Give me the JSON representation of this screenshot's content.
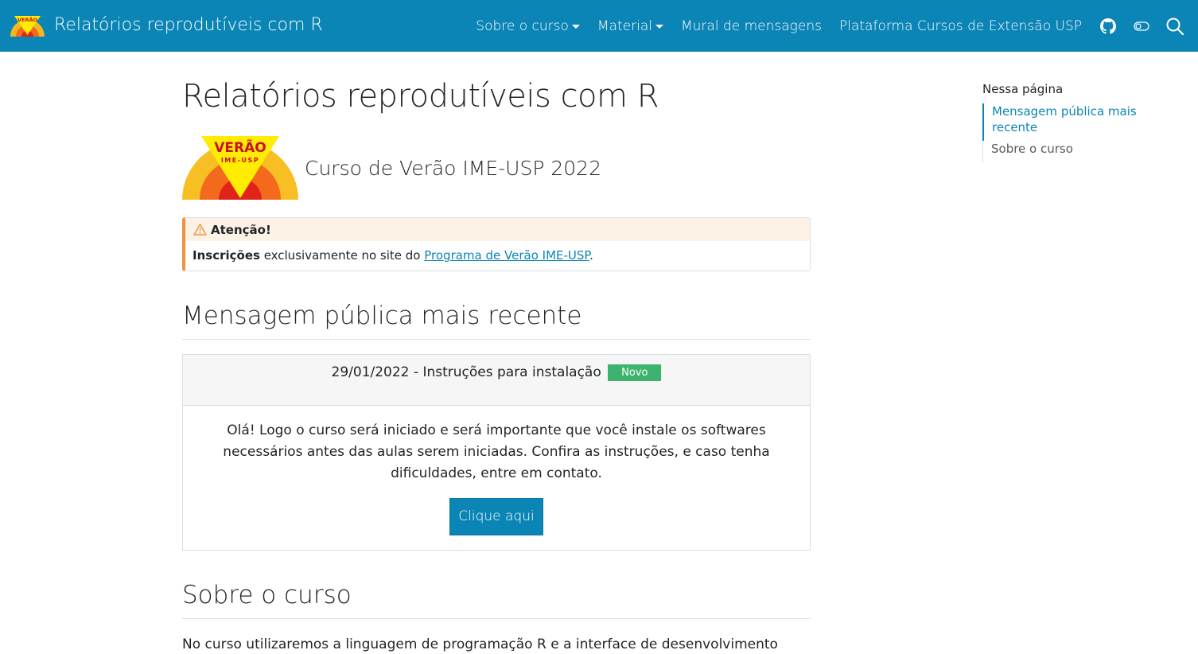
{
  "navbar": {
    "title": "Relatórios reprodutíveis com R",
    "items": [
      {
        "label": "Sobre o curso",
        "dropdown": true
      },
      {
        "label": "Material",
        "dropdown": true
      },
      {
        "label": "Mural de mensagens",
        "dropdown": false
      },
      {
        "label": "Plataforma Cursos de Extensão USP",
        "dropdown": false
      }
    ],
    "icons": [
      "github-icon",
      "toggle-icon",
      "search-icon"
    ],
    "logo_text": "VERÃO",
    "background": "#0b85b5"
  },
  "main": {
    "title": "Relatórios reprodutíveis com R",
    "hero": {
      "logo_text_top": "VERÃO",
      "logo_text_bottom": "IME-USP",
      "subtitle": "Curso de Verão IME-USP 2022"
    },
    "callout": {
      "header": "Atenção!",
      "bold": "Inscrições",
      "text": " exclusivamente no site do ",
      "link": "Programa de Verão IME-USP",
      "end": "."
    },
    "section1": "Mensagem pública mais recente",
    "card": {
      "header": "29/01/2022 - Instruções para instalação",
      "badge": "Novo",
      "body": "Olá! Logo o curso será iniciado e será importante que você instale os softwares necessários antes das aulas serem iniciadas. Confira as instruções, e caso tenha dificuldades, entre em contato.",
      "button": "Clique aqui"
    },
    "section2": "Sobre o curso",
    "intro": "No curso utilizaremos a linguagem de programação R e a interface de desenvolvimento"
  },
  "toc": {
    "title": "Nessa página",
    "items": [
      {
        "label": "Mensagem pública mais recente",
        "active": true
      },
      {
        "label": "Sobre o curso",
        "active": false
      }
    ]
  },
  "colors": {
    "accent": "#0b85b5",
    "warning": "#f0923a",
    "badge": "#3cb36f"
  }
}
